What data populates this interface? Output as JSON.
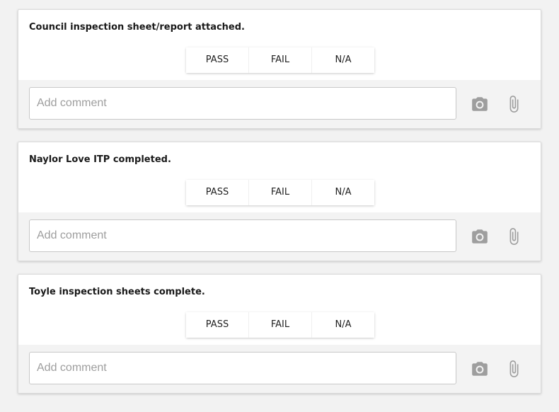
{
  "options": {
    "pass": "PASS",
    "fail": "FAIL",
    "na": "N/A"
  },
  "comment": {
    "placeholder": "Add comment"
  },
  "icons": {
    "camera": "camera-icon",
    "attach": "paperclip-icon"
  },
  "colors": {
    "icon": "#9e9e9e",
    "card_bg": "#ffffff",
    "comment_bar_bg": "#f3f3f3",
    "page_bg": "#f2f2f2"
  },
  "items": [
    {
      "title": "Council inspection sheet/report attached.",
      "comment": ""
    },
    {
      "title": "Naylor Love ITP completed.",
      "comment": ""
    },
    {
      "title": "Toyle inspection sheets complete.",
      "comment": ""
    }
  ]
}
